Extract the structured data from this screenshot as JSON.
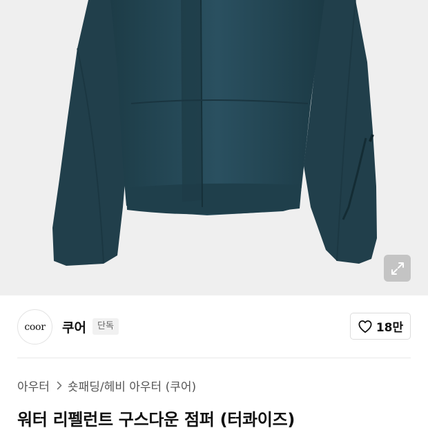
{
  "product_image": {
    "alt": "워터 리펠런트 구스다운 점퍼 (터콰이즈)",
    "jacket_color": "#244753",
    "background_color": "#efefef"
  },
  "expand_button": {
    "icon": "expand-icon"
  },
  "brand": {
    "logo_text": "coor",
    "name": "쿠어",
    "badge": "단독"
  },
  "like": {
    "icon": "heart-icon",
    "count": "18만"
  },
  "breadcrumb": {
    "items": [
      "아우터",
      "숏패딩/헤비 아우터 (쿠어)"
    ],
    "separator_icon": "chevron-right-icon"
  },
  "product": {
    "title": "워터 리펠런트 구스다운 점퍼 (터콰이즈)"
  }
}
